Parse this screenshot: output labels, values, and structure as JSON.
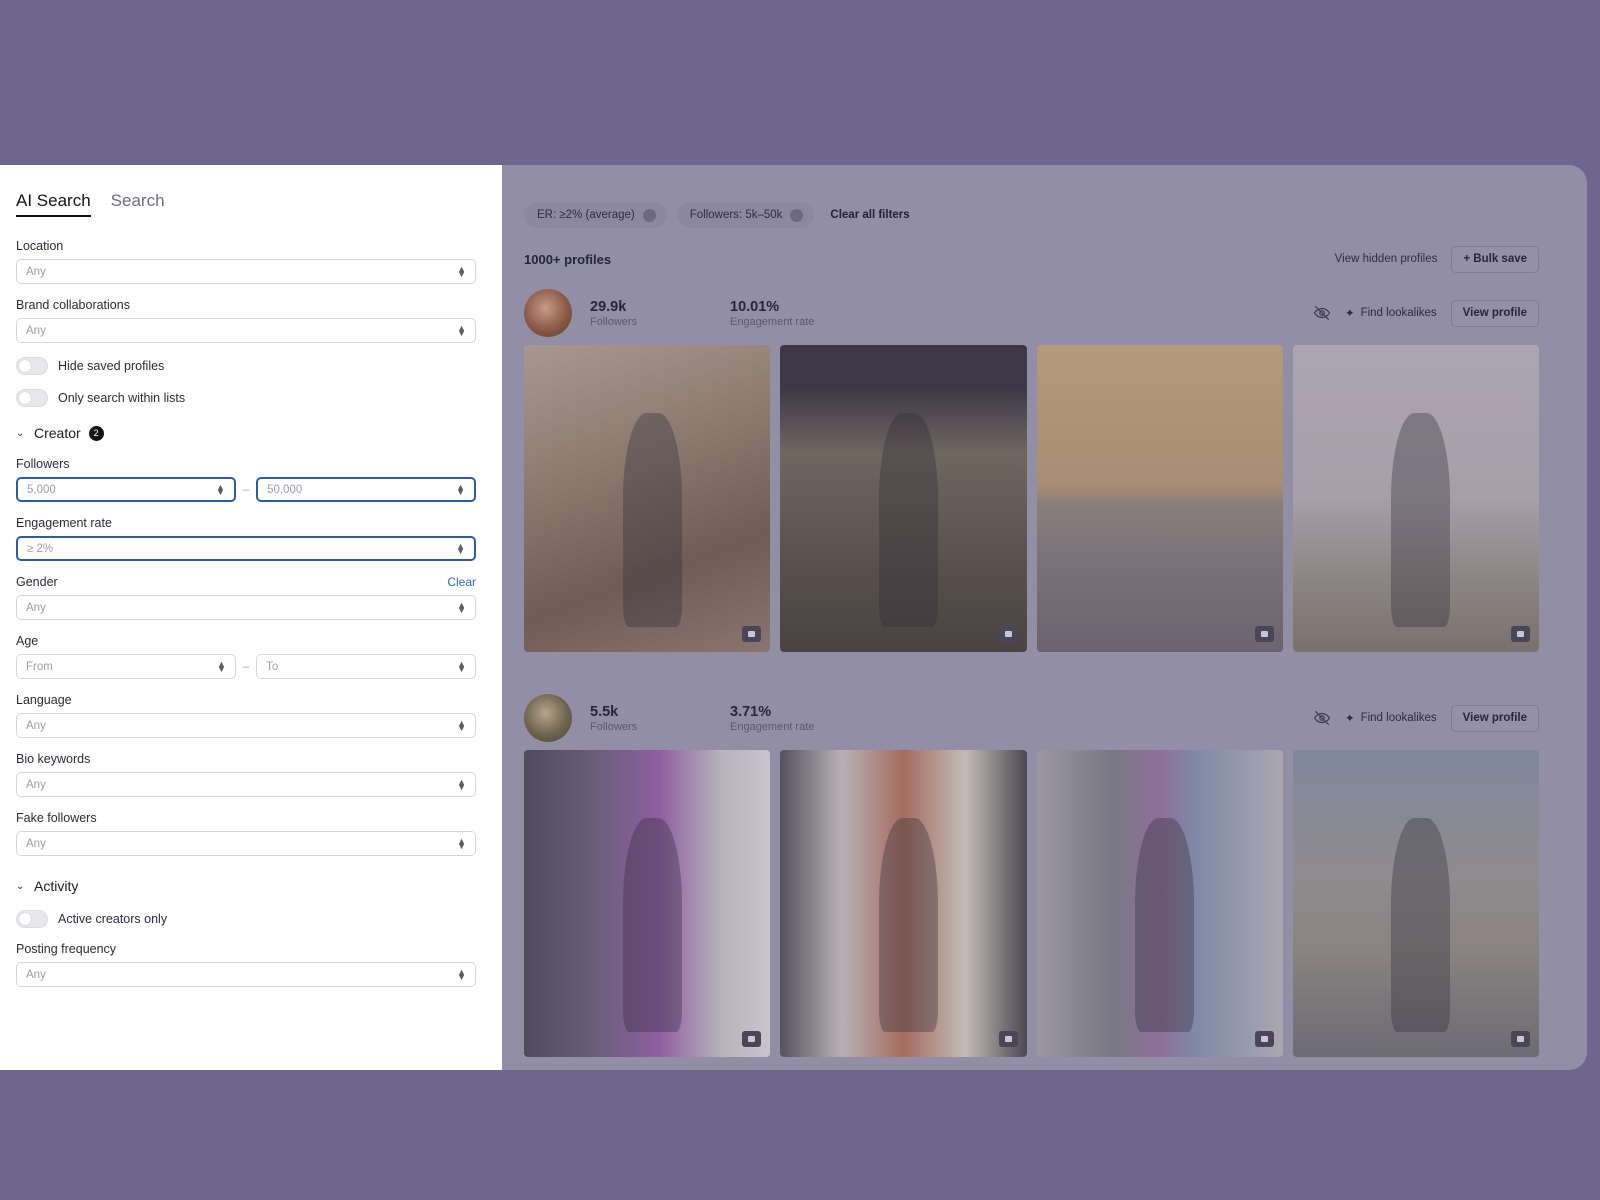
{
  "sidebar": {
    "tabs": [
      {
        "label": "AI Search",
        "active": true
      },
      {
        "label": "Search",
        "active": false
      }
    ],
    "location": {
      "label": "Location",
      "value": "Any"
    },
    "brand_collabs": {
      "label": "Brand collaborations",
      "value": "Any"
    },
    "toggles": {
      "hide_saved": "Hide saved profiles",
      "only_lists": "Only search within lists"
    },
    "creator_section": {
      "title": "Creator",
      "badge": "2",
      "followers": {
        "label": "Followers",
        "min": "5,000",
        "max": "50,000",
        "separator": "–"
      },
      "engagement": {
        "label": "Engagement rate",
        "value": "≥ 2%"
      },
      "gender": {
        "label": "Gender",
        "clear": "Clear",
        "value": "Any"
      },
      "age": {
        "label": "Age",
        "from": "From",
        "to": "To",
        "separator": "–"
      },
      "language": {
        "label": "Language",
        "value": "Any"
      },
      "bio": {
        "label": "Bio keywords",
        "value": "Any"
      },
      "fake": {
        "label": "Fake followers",
        "value": "Any"
      }
    },
    "activity_section": {
      "title": "Activity",
      "active_only": "Active creators only",
      "posting": {
        "label": "Posting frequency",
        "value": "Any"
      }
    }
  },
  "filters": {
    "chips": [
      {
        "label": "ER: ≥2% (average)"
      },
      {
        "label": "Followers: 5k–50k"
      }
    ],
    "clear_all": "Clear all filters"
  },
  "results": {
    "count": "1000+ profiles",
    "view_hidden": "View hidden profiles",
    "bulk_save": "+ Bulk save"
  },
  "profiles": [
    {
      "followers_value": "29.9k",
      "followers_label": "Followers",
      "er_value": "10.01%",
      "er_label": "Engagement rate",
      "lookalikes": "Find lookalikes",
      "view": "View profile"
    },
    {
      "followers_value": "5.5k",
      "followers_label": "Followers",
      "er_value": "3.71%",
      "er_label": "Engagement rate",
      "lookalikes": "Find lookalikes",
      "view": "View profile"
    }
  ],
  "colors": {
    "background": "#6e668d",
    "accent": "#2f5aa6",
    "overlay": "#918ea6"
  }
}
